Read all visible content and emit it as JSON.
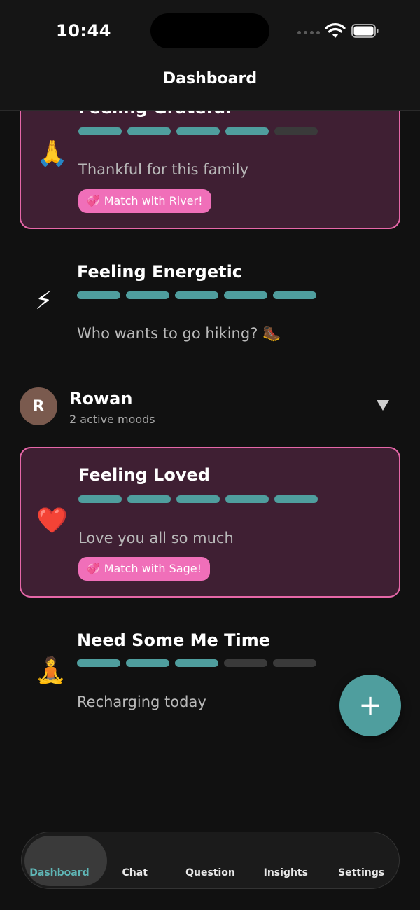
{
  "status": {
    "time": "10:44"
  },
  "header": {
    "title": "Dashboard"
  },
  "moods": [
    {
      "title": "Feeling Grateful",
      "emoji": "🙏",
      "note": "Thankful for this family",
      "level": 4,
      "max": 5,
      "matched": true,
      "match_label": "Match with River!"
    },
    {
      "title": "Feeling Energetic",
      "emoji": "⚡",
      "note": "Who wants to go hiking? 🥾",
      "level": 5,
      "max": 5,
      "matched": false
    },
    {
      "title": "Feeling Loved",
      "emoji": "❤️",
      "note": "Love you all so much",
      "level": 5,
      "max": 5,
      "matched": true,
      "match_label": "Match with Sage!"
    },
    {
      "title": "Need Some Me Time",
      "emoji": "🧘",
      "note": "Recharging today",
      "level": 3,
      "max": 5,
      "matched": false
    }
  ],
  "member": {
    "initial": "R",
    "name": "Rowan",
    "subtitle": "2 active moods"
  },
  "fab": {
    "label": "+"
  },
  "tabs": [
    {
      "label": "Dashboard",
      "active": true
    },
    {
      "label": "Chat",
      "active": false
    },
    {
      "label": "Question",
      "active": false
    },
    {
      "label": "Insights",
      "active": false
    },
    {
      "label": "Settings",
      "active": false
    }
  ],
  "colors": {
    "accent": "#4f9e9e",
    "match_border": "#e667a8",
    "match_badge": "#f06fb9",
    "card_bg": "#3f1f33",
    "active_tab_text": "#5fb6b6"
  }
}
